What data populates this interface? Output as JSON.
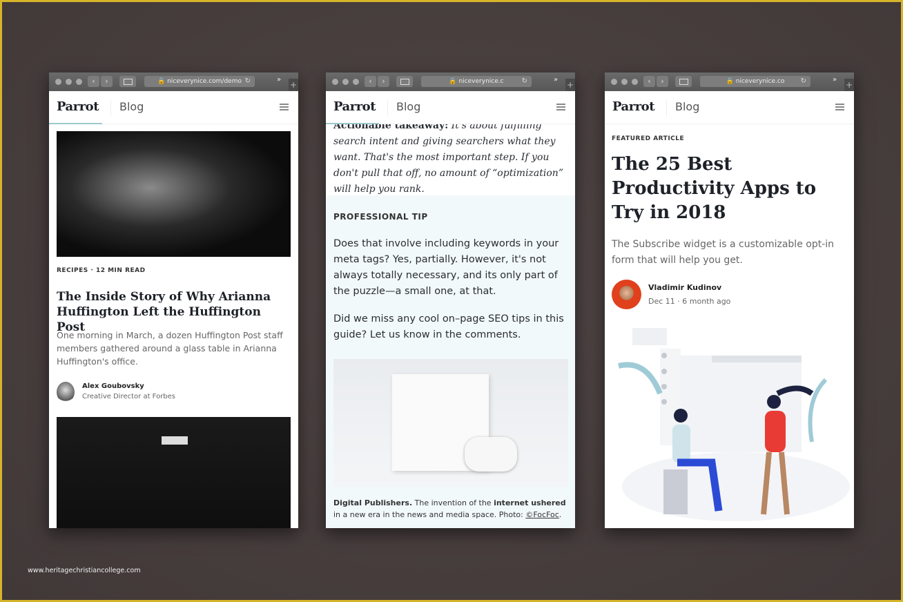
{
  "watermark": "www.heritagechristiancollege.com",
  "colors": {
    "accent": "#9cc9cc",
    "tip_bg": "#f2f9fb",
    "text": "#1e2128",
    "background": "#453c3c",
    "frame": "#d6b52a"
  },
  "windows": [
    {
      "url": "niceverynice.com/demo",
      "logo": "Parrot",
      "nav": "Blog",
      "meta": "RECIPES · 12 MIN READ",
      "title": "The Inside Story of Why Arianna Huffington Left the Huffington Post",
      "excerpt": "One morning in March, a dozen Huffington Post staff members gathered around a glass table in Arianna Huffington's office.",
      "author": {
        "name": "Alex Goubovsky",
        "role": "Creative Director at Forbes"
      }
    },
    {
      "url": "niceverynice.c",
      "logo": "Parrot",
      "nav": "Blog",
      "takeaway_label": "Actionable takeaway:",
      "takeaway": "It's about fulfilling search intent and giving searchers what they want. That's the most important step. If you don't pull that off, no amount of “optimization” will help you rank.",
      "tip_label": "PROFESSIONAL TIP",
      "p1": "Does that involve including keywords in your meta tags? Yes, partially. However, it's not always totally necessary, and its only part of the puzzle—a small one, at that.",
      "p2": "Did we miss any cool on–page SEO tips in this guide? Let us know in the comments.",
      "caption": {
        "b1": "Digital Publishers.",
        "t1": " The invention of the ",
        "b2": "internet ushered",
        "t2": " in a new era in the news and media space. Photo: ",
        "link": "©FocFoc",
        "end": "."
      }
    },
    {
      "url": "niceverynice.co",
      "logo": "Parrot",
      "nav": "Blog",
      "meta": "FEATURED ARTICLE",
      "title": "The 25 Best Productivity Apps to Try in 2018",
      "excerpt": "The Subscribe widget is a customizable opt-in form that will help you get.",
      "author": {
        "name": "Vladimir Kudinov",
        "date": "Dec 11 · 6 month ago"
      }
    }
  ]
}
